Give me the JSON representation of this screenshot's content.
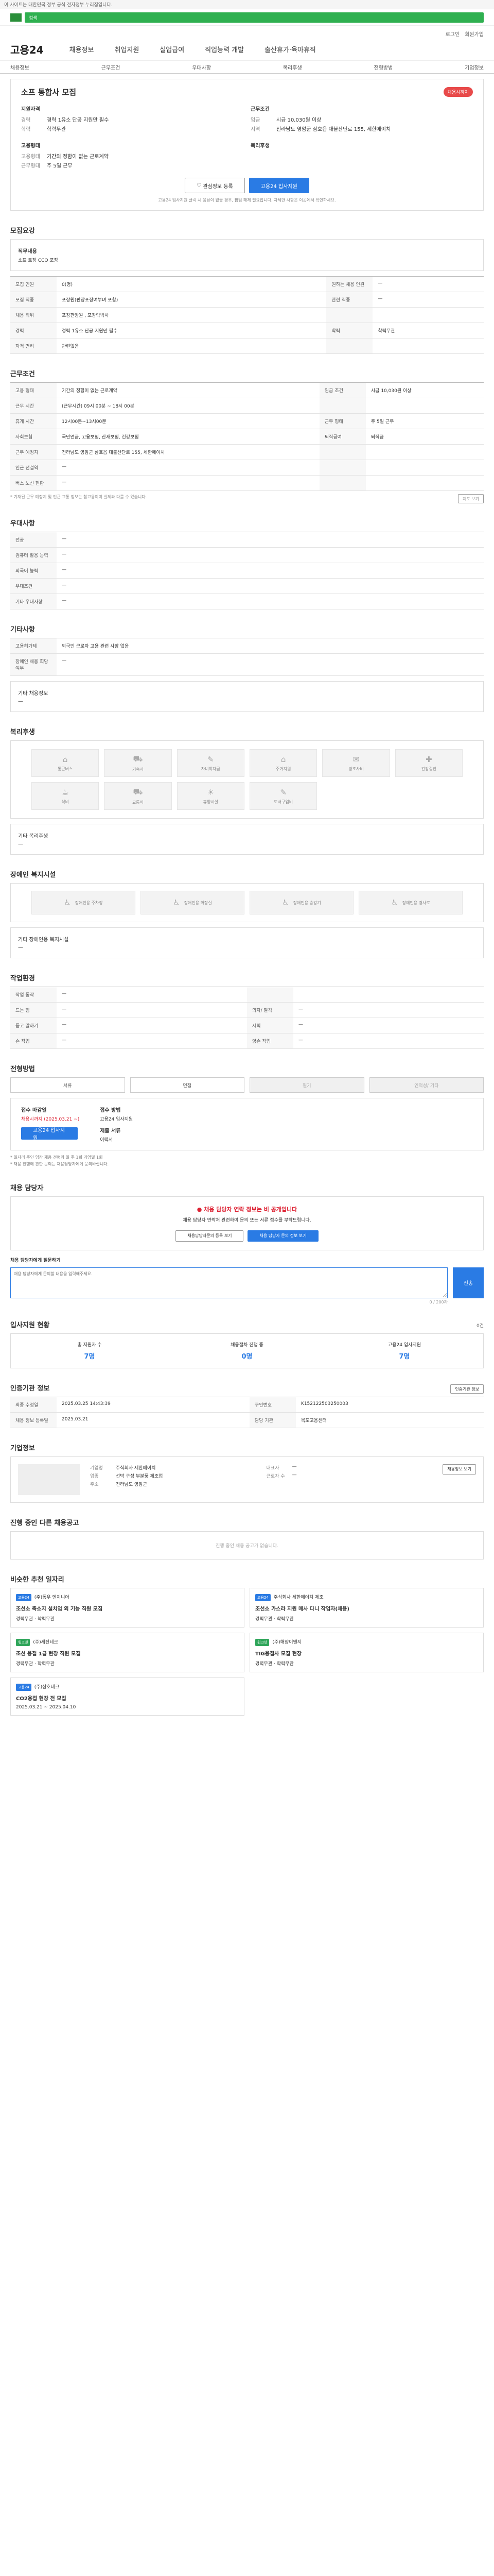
{
  "topbar": {
    "text": "이 사이트는 대한민국 정부 공식 전자정부 누리집입니다."
  },
  "search": {
    "placeholder": "검색"
  },
  "util": [
    "로그인",
    "회원가입"
  ],
  "gnb": {
    "brand": "고용24",
    "menus": [
      "채용정보",
      "취업지원",
      "실업급여",
      "직업능력 개발",
      "출산휴가·육아휴직"
    ]
  },
  "subnav": [
    "채용정보",
    "근무조건",
    "우대사항",
    "복리후생",
    "전형방법",
    "기업정보"
  ],
  "job": {
    "title": "소프 통합사 모집",
    "status": "채용시까지",
    "org_title": "지원자격",
    "career_k": "경력",
    "career_v": "경력 1유소 단공 지원만 필수",
    "edu_k": "학력",
    "edu_v": "학력무관",
    "employ_title": "고용형태",
    "employ_k": "고용형태",
    "employ_v": "기간의 정함이 없는 근로계약",
    "work_k": "근무형태",
    "work_v": "주 5일 근무",
    "cond_title": "근무조건",
    "wage_k": "임금",
    "wage_v": "시급 10,030원 이상",
    "place_k": "지역",
    "place_v": "전라남도 영암군 삼호읍 대불산단로 155, 세한에이치",
    "welfare_title": "복리후생",
    "btn_interest": "관심정보 등록",
    "btn_apply": "고용24 입사지원",
    "apply_note": "고용24 입사지원 클릭 시 응답이 없을 경우, 팝업 해제 필요합니다. 자세한 사항은 이곳에서 확인하세요."
  },
  "recruit": {
    "section": "모집요강",
    "duty_label": "직무내용",
    "duty_value": "소프 토장 CCO 포장",
    "rows": [
      [
        "모집 인원",
        "0(명)",
        "원하는 채용 인원",
        "—"
      ],
      [
        "모집 직종",
        "포장원(판장포장여부녀 포함)",
        "관련 직종",
        "—"
      ],
      [
        "채용 직위",
        "포장판장원 , 포장락박사",
        "",
        ""
      ],
      [
        "경력",
        "경력 1유소 단공 지원만 필수",
        "학력",
        "학력무관"
      ],
      [
        "자격 면허",
        "관련없음",
        "",
        ""
      ]
    ]
  },
  "conditions": {
    "section": "근무조건",
    "rows": [
      [
        "고용 형태",
        "기간의 정함이 없는 근로계약",
        "임금 조건",
        "시급 10,030원 이상"
      ],
      [
        "근무 시간",
        "(근무시간) 09시 00분 ~ 18시 00분",
        "",
        ""
      ],
      [
        "휴게 시간",
        "12시00분~13시00분",
        "근무 형태",
        "주 5일 근무"
      ],
      [
        "사회보험",
        "국민연금, 고용보험, 산재보험, 건강보험",
        "퇴직급여",
        "퇴직금"
      ],
      [
        "근무 예정지",
        "전라남도 영암군 삼호읍 대불산단로 155, 세한에이치",
        "",
        ""
      ],
      [
        "인근 전철역",
        "—",
        "",
        ""
      ],
      [
        "버스 노선 현황",
        "—",
        "",
        ""
      ]
    ],
    "map_button": "지도 보기",
    "note": "* 기재된 근무 예정지 및 인근 교통 정보는 참고용이며 실제와 다를 수 있습니다."
  },
  "preference": {
    "section": "우대사항",
    "rows": [
      [
        "전공",
        "—"
      ],
      [
        "컴퓨터 활용 능력",
        "—"
      ],
      [
        "외국어 능력",
        "—"
      ],
      [
        "우대조건",
        "—"
      ],
      [
        "기타 우대사항",
        "—"
      ]
    ]
  },
  "etc": {
    "section": "기타사항",
    "rows": [
      [
        "고용허가제",
        "외국인 근로자 고용 관련 사항 없음"
      ],
      [
        "장애인 채용 희망 여부",
        "—"
      ]
    ],
    "extra_label": "기타 채용정보",
    "extra_value": "—"
  },
  "welfare": {
    "section": "복리후생",
    "icons": [
      "통근버스",
      "기숙사",
      "자녀학자금",
      "주거지원",
      "경조사비",
      "건강검진",
      "식비",
      "교통비",
      "휴양시설",
      "도서구입비"
    ],
    "extra_label": "기타 복리후생",
    "extra_value": "—"
  },
  "disabled": {
    "section": "장애인 복지시설",
    "icons": [
      "장애인용 주차장",
      "장애인용 화장실",
      "장애인용 승강기",
      "장애인용 경사로"
    ],
    "extra_label": "기타 장애인용 복지시설",
    "extra_value": "—"
  },
  "env": {
    "section": "작업환경",
    "rows": [
      [
        "작업 동작",
        "—",
        "",
        ""
      ],
      [
        "드는 힘",
        "—",
        "의자/ 팔각",
        "—"
      ],
      [
        "듣고 말하기",
        "—",
        "시력",
        "—"
      ],
      [
        "손 작업",
        "—",
        "양손 작업",
        "—"
      ]
    ]
  },
  "method": {
    "section": "전형방법",
    "steps": [
      "서류",
      "면접",
      "필기",
      "인적성/ 기타"
    ],
    "deadline_label": "접수 마감일",
    "deadline_value": "채용시까지 (2025.03.21 ~)",
    "apply_method_label": "접수 방법",
    "apply_method_value": "고용24 입사지원",
    "docs_label": "제출 서류",
    "docs_value": "이력서",
    "btn": "고용24 입사지원",
    "bullets": [
      "* 일자리 주인 입장 채용 전형의 일 주 1회 기업별 1회",
      "* 채용 진행에 관한 문의는 채용담당자에게 문의바랍니다."
    ]
  },
  "contact": {
    "section": "채용 담당자",
    "alert": "채용 담당자 연락 정보는 비 공개입니다",
    "alert_desc": "채용 담당자 연락처 관련하여 문의 또는 서류 접수를 부탁드립니다.",
    "btn_a": "채용담당자문의 등록 보기",
    "btn_b": "채용 담당자 문의 정보 보기",
    "inq_label": "채용 담당자에게 질문하기",
    "inq_placeholder": "채용 담당자에게 문의할 내용을 입력해주세요.",
    "inq_send": "전송",
    "inq_count": "0 / 200자"
  },
  "stats": {
    "section": "입사지원 현황",
    "total": "0건",
    "items": [
      {
        "label": "총 지원자 수",
        "value": "7명"
      },
      {
        "label": "채용절차 진행 중",
        "value": "0명"
      },
      {
        "label": "고용24 입사지원",
        "value": "7명"
      }
    ]
  },
  "regist": {
    "section": "인증기관 정보",
    "btn": "인증기관 정보",
    "rows": [
      [
        "최종 수정일",
        "2025.03.25 14:43:39",
        "구인번호",
        "K152122503250003"
      ],
      [
        "채용 정보 등록일",
        "2025.03.21",
        "담당 기관",
        "목포고용센터"
      ]
    ]
  },
  "company": {
    "section": "기업정보",
    "name_k": "기업명",
    "name_v": "주식회사 세한에이치",
    "rep_k": "대표자",
    "rep_v": "—",
    "ind_k": "업종",
    "ind_v": "선박 구성 부분품 제조업",
    "emp_k": "근로자 수",
    "emp_v": "—",
    "addr_k": "주소",
    "addr_v": "전라남도 영암군",
    "btn": "채용정보 보기"
  },
  "other": {
    "section": "진행 중인 다른 채용공고",
    "empty": "진행 중인 채용 공고가 없습니다."
  },
  "recommend": {
    "section": "비슷한 추천 일자리",
    "jobs": [
      {
        "tag": "고용24",
        "org": "(주)동우 엔지니어",
        "title": "조선소 축소지 설치업 외 기능 직원 모집",
        "meta": "경력무관 · 학력무관"
      },
      {
        "tag": "고용24",
        "org": "주식회사 세한에이치 제조",
        "title": "조선소 가스라 지원 매사 다니 작업자(채용)",
        "meta": "경력무관 · 학력무관"
      },
      {
        "tag": "워크넷",
        "org": "(주)세진테크",
        "title": "조선 용접 1급 현장 직원 모집",
        "meta": "경력무관 · 학력무관"
      },
      {
        "tag": "워크넷",
        "org": "(주)해양이엔지",
        "title": "TIG용접사 모집 현장",
        "meta": "경력무관 · 학력무관"
      },
      {
        "tag": "고용24",
        "org": "(주)삼호테크",
        "title": "CO2용접 현장 전 모집",
        "meta": "2025.03.21 ~ 2025.04.10"
      }
    ]
  }
}
